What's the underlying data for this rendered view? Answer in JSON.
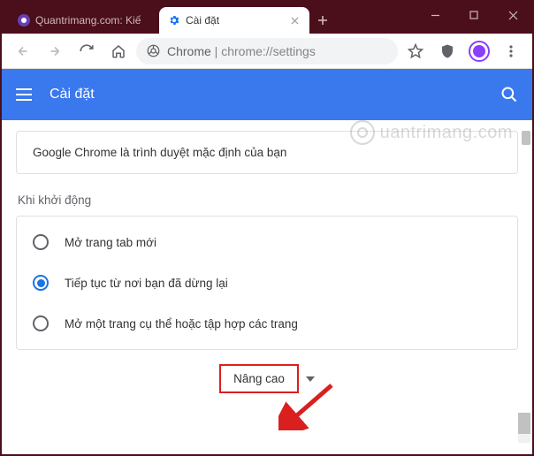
{
  "titlebar": {
    "tabs": [
      {
        "title": "Quantrimang.com: Kiế",
        "active": false
      },
      {
        "title": "Cài đặt",
        "active": true
      }
    ]
  },
  "toolbar": {
    "address_host": "Chrome",
    "address_path": "chrome://settings"
  },
  "header": {
    "title": "Cài đặt"
  },
  "main": {
    "default_browser_text": "Google Chrome là trình duyệt mặc định của bạn",
    "startup_title": "Khi khởi động",
    "startup_options": [
      "Mở trang tab mới",
      "Tiếp tục từ nơi bạn đã dừng lại",
      "Mở một trang cụ thể hoặc tập hợp các trang"
    ],
    "startup_selected_index": 1,
    "advanced_label": "Nâng cao"
  },
  "watermark": {
    "text": "uantrimang.com"
  }
}
